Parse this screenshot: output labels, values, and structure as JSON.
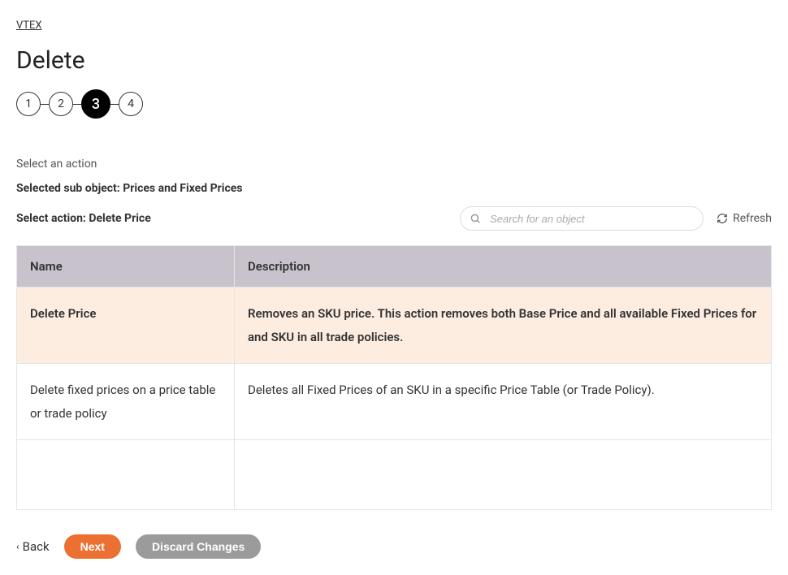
{
  "breadcrumb": "VTEX",
  "title": "Delete",
  "stepper": {
    "steps": [
      "1",
      "2",
      "3",
      "4"
    ],
    "active_index": 2
  },
  "instruction": "Select an action",
  "selected_sub_object_label": "Selected sub object: Prices and Fixed Prices",
  "select_action_label": "Select action: Delete Price",
  "search": {
    "placeholder": "Search for an object"
  },
  "refresh_label": "Refresh",
  "table": {
    "headers": {
      "name": "Name",
      "description": "Description"
    },
    "rows": [
      {
        "name": "Delete Price",
        "description": "Removes an SKU price. This action removes both Base Price and all available Fixed Prices for and SKU in all trade policies.",
        "selected": true
      },
      {
        "name": "Delete fixed prices on a price table or trade policy",
        "description": "Deletes all Fixed Prices of an SKU in a specific Price Table (or Trade Policy).",
        "selected": false
      }
    ]
  },
  "footer": {
    "back": "Back",
    "next": "Next",
    "discard": "Discard Changes"
  }
}
